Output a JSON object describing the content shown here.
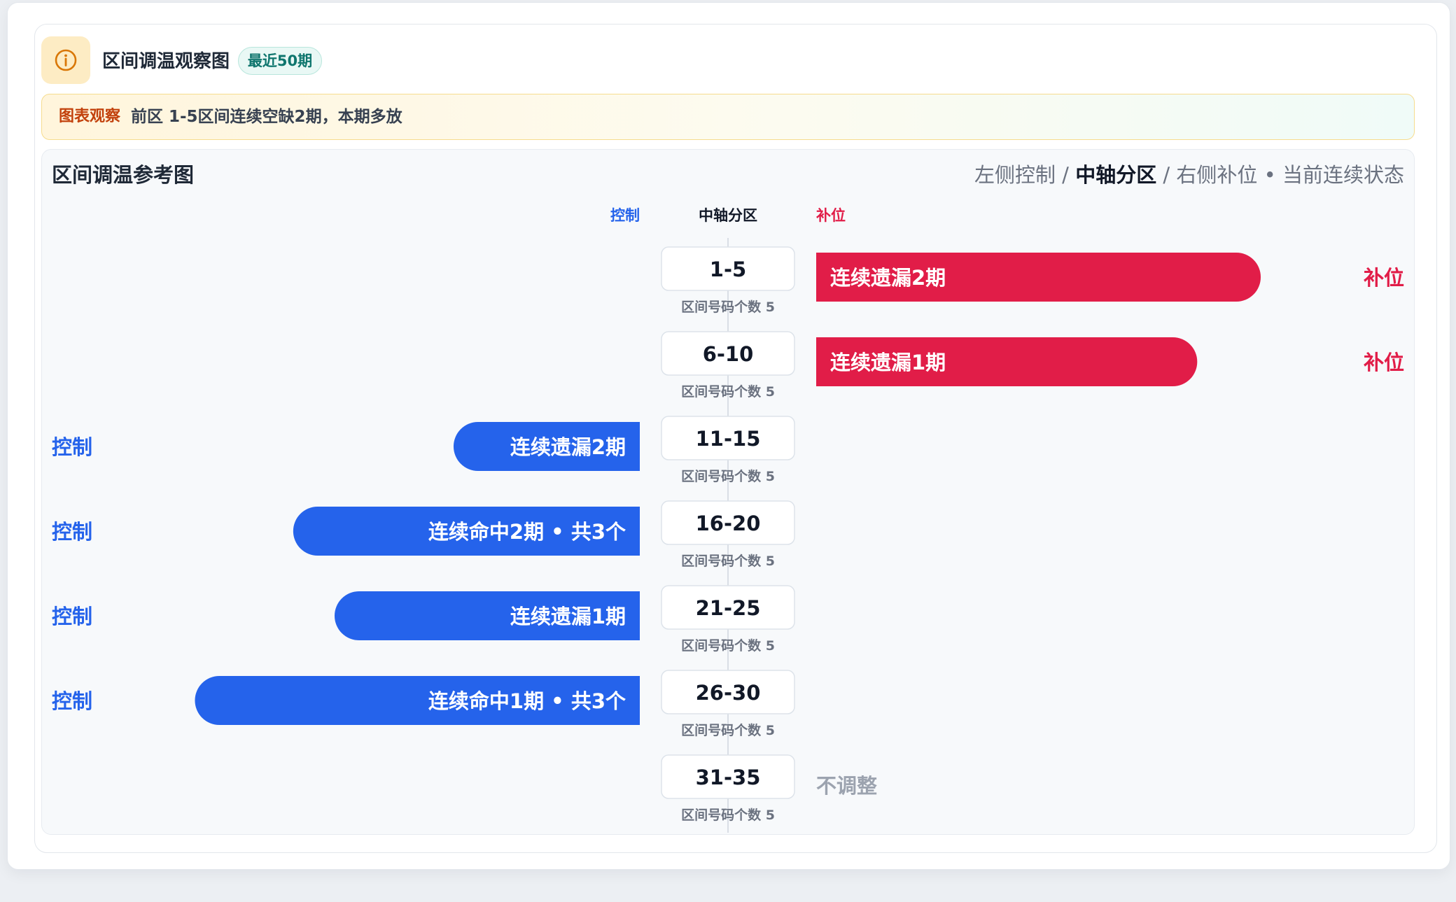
{
  "header": {
    "title": "区间调温观察图",
    "badge": "最近50期"
  },
  "banner": {
    "tag": "图表观察",
    "text": "前区 1-5区间连续空缺2期，本期多放"
  },
  "panel": {
    "title": "区间调温参考图",
    "legend": {
      "left": "左侧控制",
      "sep1": " / ",
      "center": "中轴分区",
      "sep2": " / ",
      "right": "右侧补位",
      "dot": " • ",
      "status": "当前连续状态"
    }
  },
  "colors": {
    "control": "#2563eb",
    "fill": "#e11d48",
    "neutral": "#9ca3af",
    "axis_box_border": "#dde3ea",
    "sub_label": "#6b7280"
  },
  "chart_data": {
    "type": "bar",
    "orientation": "diverging-horizontal",
    "column_headers": {
      "left": "控制",
      "center": "中轴分区",
      "right": "补位"
    },
    "categories": [
      "1-5",
      "6-10",
      "11-15",
      "16-20",
      "21-25",
      "26-30",
      "31-35"
    ],
    "sub_labels": [
      "区间号码个数 5",
      "区间号码个数 5",
      "区间号码个数 5",
      "区间号码个数 5",
      "区间号码个数 5",
      "区间号码个数 5",
      "区间号码个数 5"
    ],
    "rows": [
      {
        "category": "1-5",
        "side": "right",
        "value": 0.84,
        "label": "连续遗漏2期",
        "tag": "补位"
      },
      {
        "category": "6-10",
        "side": "right",
        "value": 0.72,
        "label": "连续遗漏1期",
        "tag": "补位"
      },
      {
        "category": "11-15",
        "side": "left",
        "value": 0.36,
        "label": "连续遗漏2期",
        "tag": "控制"
      },
      {
        "category": "16-20",
        "side": "left",
        "value": 0.67,
        "label": "连续命中2期 • 共3个",
        "tag": "控制"
      },
      {
        "category": "21-25",
        "side": "left",
        "value": 0.59,
        "label": "连续遗漏1期",
        "tag": "控制"
      },
      {
        "category": "26-30",
        "side": "left",
        "value": 0.86,
        "label": "连续命中1期 • 共3个",
        "tag": "控制"
      },
      {
        "category": "31-35",
        "side": "none",
        "value": 0,
        "label": "不调整",
        "tag": ""
      }
    ]
  }
}
